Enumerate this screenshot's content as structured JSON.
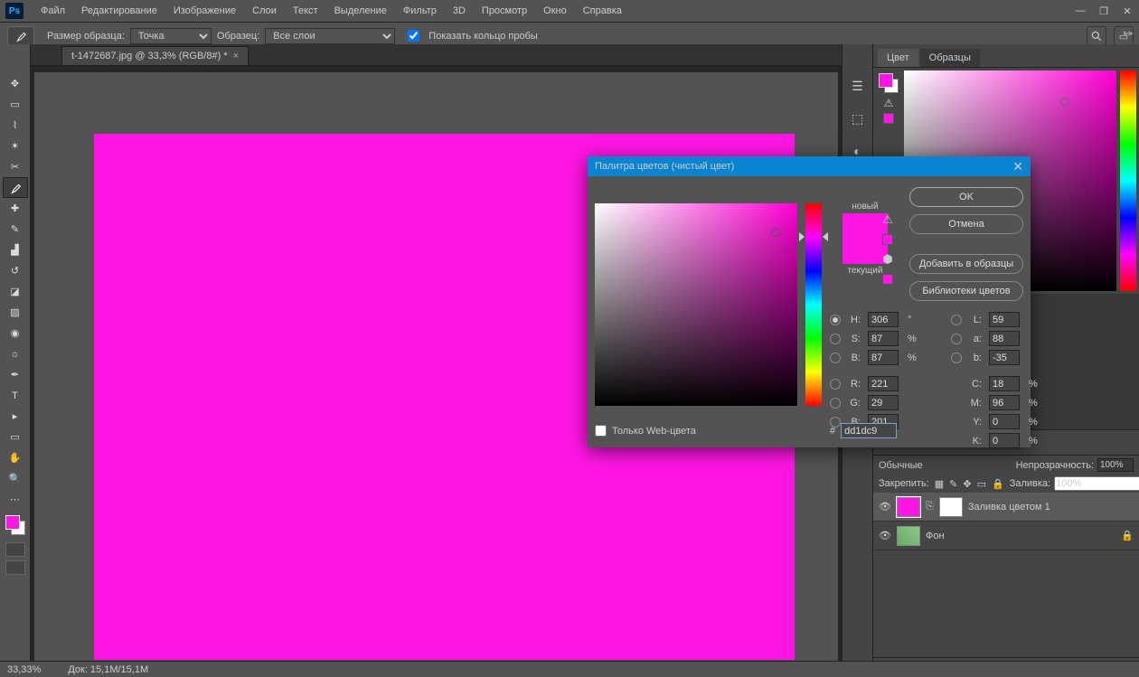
{
  "app": {
    "logo_text": "Ps"
  },
  "menu": [
    "Файл",
    "Редактирование",
    "Изображение",
    "Слои",
    "Текст",
    "Выделение",
    "Фильтр",
    "3D",
    "Просмотр",
    "Окно",
    "Справка"
  ],
  "options_bar": {
    "sample_size_label": "Размер образца:",
    "sample_size_value": "Точка",
    "sample_label": "Образец:",
    "sample_value": "Все слои",
    "ring_checkbox_label": "Показать кольцо пробы",
    "ring_checked": true
  },
  "document": {
    "tab_title": "t-1472687.jpg @ 33,3% (RGB/8#) *"
  },
  "panels": {
    "tabs": {
      "color": "Цвет",
      "swatches": "Образцы"
    },
    "layers": {
      "opacity_label": "Непрозрачность:",
      "opacity_value": "100%",
      "lock_label": "Закрепить:",
      "fill_label": "Заливка:",
      "fill_value": "100%",
      "layer1_name": "Заливка цветом 1",
      "layer2_name": "Фон"
    }
  },
  "status": {
    "zoom": "33,33%",
    "doc": "Док: 15,1M/15,1M"
  },
  "dialog": {
    "title": "Палитра цветов (чистый цвет)",
    "new_label": "новый",
    "current_label": "текущий",
    "buttons": {
      "ok": "OK",
      "cancel": "Отмена",
      "add": "Добавить в образцы",
      "libs": "Библиотеки цветов"
    },
    "webonly_label": "Только Web-цвета",
    "values": {
      "H": "306",
      "H_unit": "°",
      "S": "87",
      "S_unit": "%",
      "Bv": "87",
      "Bv_unit": "%",
      "L": "59",
      "a": "88",
      "b": "-35",
      "R": "221",
      "G": "29",
      "Bc": "201",
      "C": "18",
      "M": "96",
      "Y": "0",
      "K": "0",
      "hex": "dd1dc9"
    }
  }
}
